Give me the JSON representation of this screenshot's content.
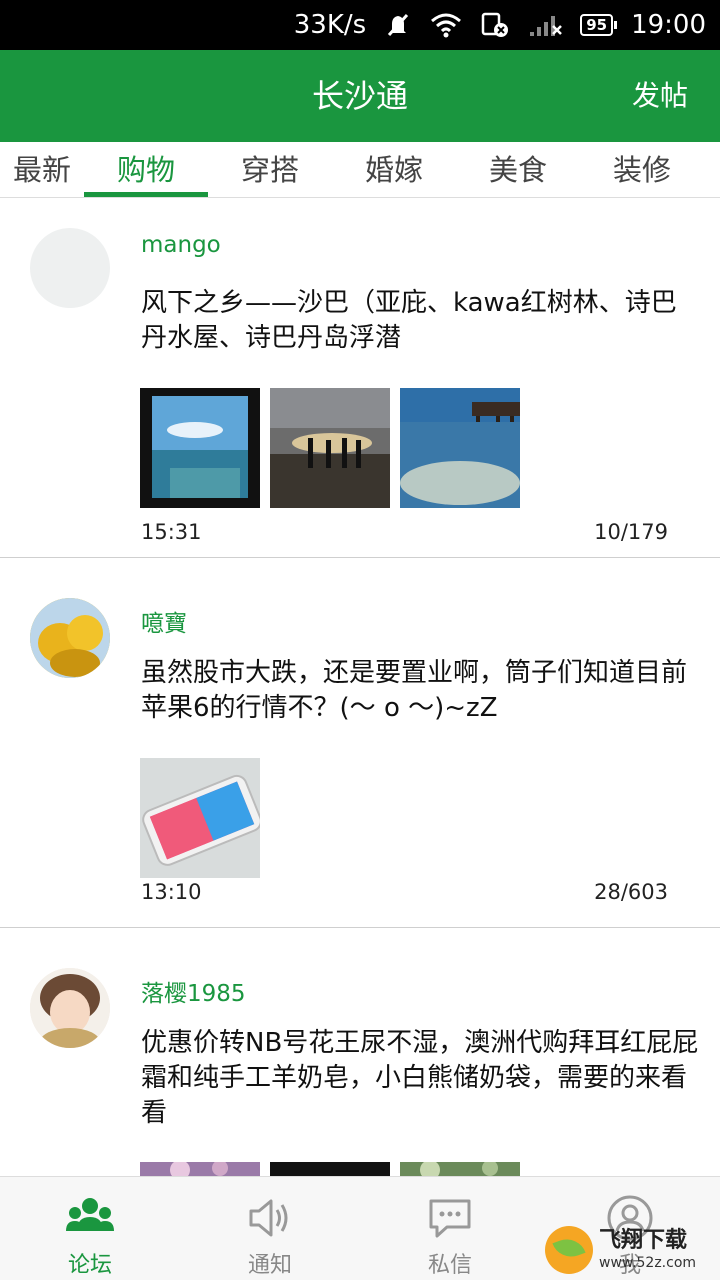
{
  "status_bar": {
    "speed": "33K/s",
    "battery": "95",
    "time": "19:00"
  },
  "app_bar": {
    "title": "长沙通",
    "post_button": "发帖"
  },
  "tabs": [
    {
      "label": "最新",
      "active": false
    },
    {
      "label": "购物",
      "active": true
    },
    {
      "label": "穿搭",
      "active": false
    },
    {
      "label": "婚嫁",
      "active": false
    },
    {
      "label": "美食",
      "active": false
    },
    {
      "label": "装修",
      "active": false
    }
  ],
  "posts": [
    {
      "author": "mango",
      "content": "风下之乡——沙巴（亚庇、kawa红树林、诗巴丹水屋、诗巴丹岛浮潜",
      "time": "15:31",
      "stats": "10/179",
      "images": [
        "ocean-doorway-photo",
        "sunset-beach-photo",
        "water-villa-photo"
      ]
    },
    {
      "author": "噫寶",
      "content": "虽然股市大跌，还是要置业啊，筒子们知道目前苹果6的行情不？(～ o ～)~zZ",
      "time": "13:10",
      "stats": "28/603",
      "images": [
        "iphone-photo"
      ]
    },
    {
      "author": "落樱1985",
      "content": "优惠价转NB号花王尿不湿，澳洲代购拜耳红屁屁霜和纯手工羊奶皂，小白熊储奶袋，需要的来看看",
      "images": [
        "flowers-photo",
        "dark-photo",
        "leaves-photo"
      ]
    }
  ],
  "bottom_nav": [
    {
      "label": "论坛",
      "icon": "people-icon",
      "active": true
    },
    {
      "label": "通知",
      "icon": "speaker-icon",
      "active": false
    },
    {
      "label": "私信",
      "icon": "chat-icon",
      "active": false
    },
    {
      "label": "我",
      "icon": "profile-icon",
      "active": false
    }
  ],
  "watermark": {
    "name": "飞翔下载",
    "url": "www.52z.com"
  },
  "colors": {
    "brand_green": "#1a963f",
    "status_bar": "#000000"
  }
}
